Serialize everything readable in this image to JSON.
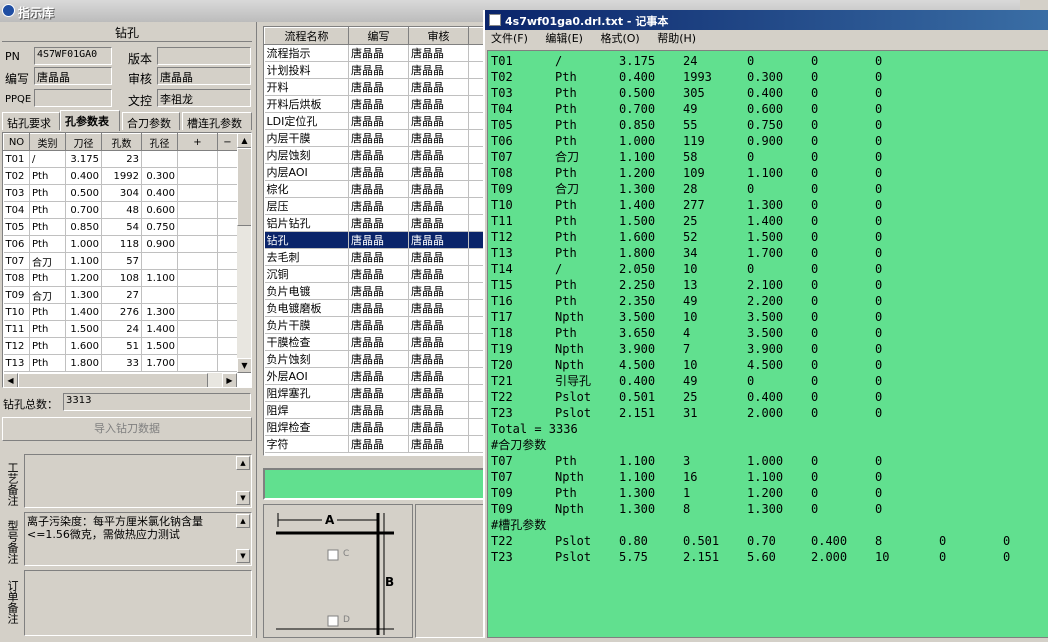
{
  "window": {
    "title": "指示库"
  },
  "drill_header": "钻孔",
  "fields": {
    "pn_label": "PN",
    "pn_value": "4S7WF01GA0",
    "version_label": "版本",
    "version_value": "",
    "editor_label": "编写",
    "editor_value": "唐晶晶",
    "review_label": "审核",
    "review_value": "唐晶晶",
    "ppqe_label": "PPQE",
    "ppqe_value": "",
    "doc_label": "文控",
    "doc_value": "李祖龙"
  },
  "tabs": [
    "钻孔要求",
    "孔参数表",
    "合刀参数",
    "槽连孔参数"
  ],
  "hole_table": {
    "headers": [
      "NO",
      "类别",
      "刀径",
      "孔数",
      "孔径",
      "+",
      "−"
    ],
    "rows": [
      [
        "T01",
        "/",
        "3.175",
        "23",
        ""
      ],
      [
        "T02",
        "Pth",
        "0.400",
        "1992",
        "0.300"
      ],
      [
        "T03",
        "Pth",
        "0.500",
        "304",
        "0.400"
      ],
      [
        "T04",
        "Pth",
        "0.700",
        "48",
        "0.600"
      ],
      [
        "T05",
        "Pth",
        "0.850",
        "54",
        "0.750"
      ],
      [
        "T06",
        "Pth",
        "1.000",
        "118",
        "0.900"
      ],
      [
        "T07",
        "合刀",
        "1.100",
        "57",
        ""
      ],
      [
        "T08",
        "Pth",
        "1.200",
        "108",
        "1.100"
      ],
      [
        "T09",
        "合刀",
        "1.300",
        "27",
        ""
      ],
      [
        "T10",
        "Pth",
        "1.400",
        "276",
        "1.300"
      ],
      [
        "T11",
        "Pth",
        "1.500",
        "24",
        "1.400"
      ],
      [
        "T12",
        "Pth",
        "1.600",
        "51",
        "1.500"
      ],
      [
        "T13",
        "Pth",
        "1.800",
        "33",
        "1.700"
      ]
    ]
  },
  "total_label": "钻孔总数：",
  "total_value": "3313",
  "import_button": "导入钻刀数据",
  "notes": {
    "craft_label": "工艺备注",
    "craft_value": "",
    "model_label": "型号备注",
    "model_value": "离子污染度：每平方厘米氯化钠含量<=1.56微克，需做热应力测试",
    "order_label": "订单备注",
    "order_value": ""
  },
  "process_table": {
    "headers": [
      "流程名称",
      "编写",
      "审核"
    ],
    "rows": [
      [
        "流程指示",
        "唐晶晶",
        "唐晶晶"
      ],
      [
        "计划投料",
        "唐晶晶",
        "唐晶晶"
      ],
      [
        "开料",
        "唐晶晶",
        "唐晶晶"
      ],
      [
        "开料后烘板",
        "唐晶晶",
        "唐晶晶"
      ],
      [
        "LDI定位孔",
        "唐晶晶",
        "唐晶晶"
      ],
      [
        "内层干膜",
        "唐晶晶",
        "唐晶晶"
      ],
      [
        "内层蚀刻",
        "唐晶晶",
        "唐晶晶"
      ],
      [
        "内层AOI",
        "唐晶晶",
        "唐晶晶"
      ],
      [
        "棕化",
        "唐晶晶",
        "唐晶晶"
      ],
      [
        "层压",
        "唐晶晶",
        "唐晶晶"
      ],
      [
        "铝片钻孔",
        "唐晶晶",
        "唐晶晶"
      ],
      [
        "钻孔",
        "唐晶晶",
        "唐晶晶"
      ],
      [
        "去毛刺",
        "唐晶晶",
        "唐晶晶"
      ],
      [
        "沉铜",
        "唐晶晶",
        "唐晶晶"
      ],
      [
        "负片电镀",
        "唐晶晶",
        "唐晶晶"
      ],
      [
        "负电镀磨板",
        "唐晶晶",
        "唐晶晶"
      ],
      [
        "负片干膜",
        "唐晶晶",
        "唐晶晶"
      ],
      [
        "干膜检查",
        "唐晶晶",
        "唐晶晶"
      ],
      [
        "负片蚀刻",
        "唐晶晶",
        "唐晶晶"
      ],
      [
        "外层AOI",
        "唐晶晶",
        "唐晶晶"
      ],
      [
        "阻焊塞孔",
        "唐晶晶",
        "唐晶晶"
      ],
      [
        "阻焊",
        "唐晶晶",
        "唐晶晶"
      ],
      [
        "阻焊检查",
        "唐晶晶",
        "唐晶晶"
      ],
      [
        "字符",
        "唐晶晶",
        "唐晶晶"
      ]
    ],
    "selected_index": 11
  },
  "diagram": {
    "label_a": "A",
    "label_b": "B",
    "label_c": "C",
    "label_d": "D"
  },
  "notepad": {
    "title": "4s7wf01ga0.drl.txt - 记事本",
    "menu": [
      "文件(F)",
      "编辑(E)",
      "格式(O)",
      "帮助(H)"
    ],
    "tools": [
      [
        "T01",
        "/",
        "3.175",
        "24",
        "0",
        "0",
        "0"
      ],
      [
        "T02",
        "Pth",
        "0.400",
        "1993",
        "0.300",
        "0",
        "0"
      ],
      [
        "T03",
        "Pth",
        "0.500",
        "305",
        "0.400",
        "0",
        "0"
      ],
      [
        "T04",
        "Pth",
        "0.700",
        "49",
        "0.600",
        "0",
        "0"
      ],
      [
        "T05",
        "Pth",
        "0.850",
        "55",
        "0.750",
        "0",
        "0"
      ],
      [
        "T06",
        "Pth",
        "1.000",
        "119",
        "0.900",
        "0",
        "0"
      ],
      [
        "T07",
        "合刀",
        "1.100",
        "58",
        "0",
        "0",
        "0"
      ],
      [
        "T08",
        "Pth",
        "1.200",
        "109",
        "1.100",
        "0",
        "0"
      ],
      [
        "T09",
        "合刀",
        "1.300",
        "28",
        "0",
        "0",
        "0"
      ],
      [
        "T10",
        "Pth",
        "1.400",
        "277",
        "1.300",
        "0",
        "0"
      ],
      [
        "T11",
        "Pth",
        "1.500",
        "25",
        "1.400",
        "0",
        "0"
      ],
      [
        "T12",
        "Pth",
        "1.600",
        "52",
        "1.500",
        "0",
        "0"
      ],
      [
        "T13",
        "Pth",
        "1.800",
        "34",
        "1.700",
        "0",
        "0"
      ],
      [
        "T14",
        "/",
        "2.050",
        "10",
        "0",
        "0",
        "0"
      ],
      [
        "T15",
        "Pth",
        "2.250",
        "13",
        "2.100",
        "0",
        "0"
      ],
      [
        "T16",
        "Pth",
        "2.350",
        "49",
        "2.200",
        "0",
        "0"
      ],
      [
        "T17",
        "Npth",
        "3.500",
        "10",
        "3.500",
        "0",
        "0"
      ],
      [
        "T18",
        "Pth",
        "3.650",
        "4",
        "3.500",
        "0",
        "0"
      ],
      [
        "T19",
        "Npth",
        "3.900",
        "7",
        "3.900",
        "0",
        "0"
      ],
      [
        "T20",
        "Npth",
        "4.500",
        "10",
        "4.500",
        "0",
        "0"
      ],
      [
        "T21",
        "引导孔",
        "0.400",
        "49",
        "0",
        "0",
        "0"
      ],
      [
        "T22",
        "Pslot",
        "0.501",
        "25",
        "0.400",
        "0",
        "0"
      ],
      [
        "T23",
        "Pslot",
        "2.151",
        "31",
        "2.000",
        "0",
        "0"
      ]
    ],
    "total_line": "Total = 3336",
    "merge_header": "#合刀参数",
    "merge_rows": [
      [
        "T07",
        "Pth",
        "1.100",
        "3",
        "1.000",
        "0",
        "0"
      ],
      [
        "T07",
        "Npth",
        "1.100",
        "16",
        "1.100",
        "0",
        "0"
      ],
      [
        "T09",
        "Pth",
        "1.300",
        "1",
        "1.200",
        "0",
        "0"
      ],
      [
        "T09",
        "Npth",
        "1.300",
        "8",
        "1.300",
        "0",
        "0"
      ]
    ],
    "slot_header": "#槽孔参数",
    "slot_rows": [
      [
        "T22",
        "Pslot",
        "0.80",
        "0.501",
        "0.70",
        "0.400",
        "8",
        "0",
        "0"
      ],
      [
        "T23",
        "Pslot",
        "5.75",
        "2.151",
        "5.60",
        "2.000",
        "10",
        "0",
        "0"
      ]
    ]
  }
}
